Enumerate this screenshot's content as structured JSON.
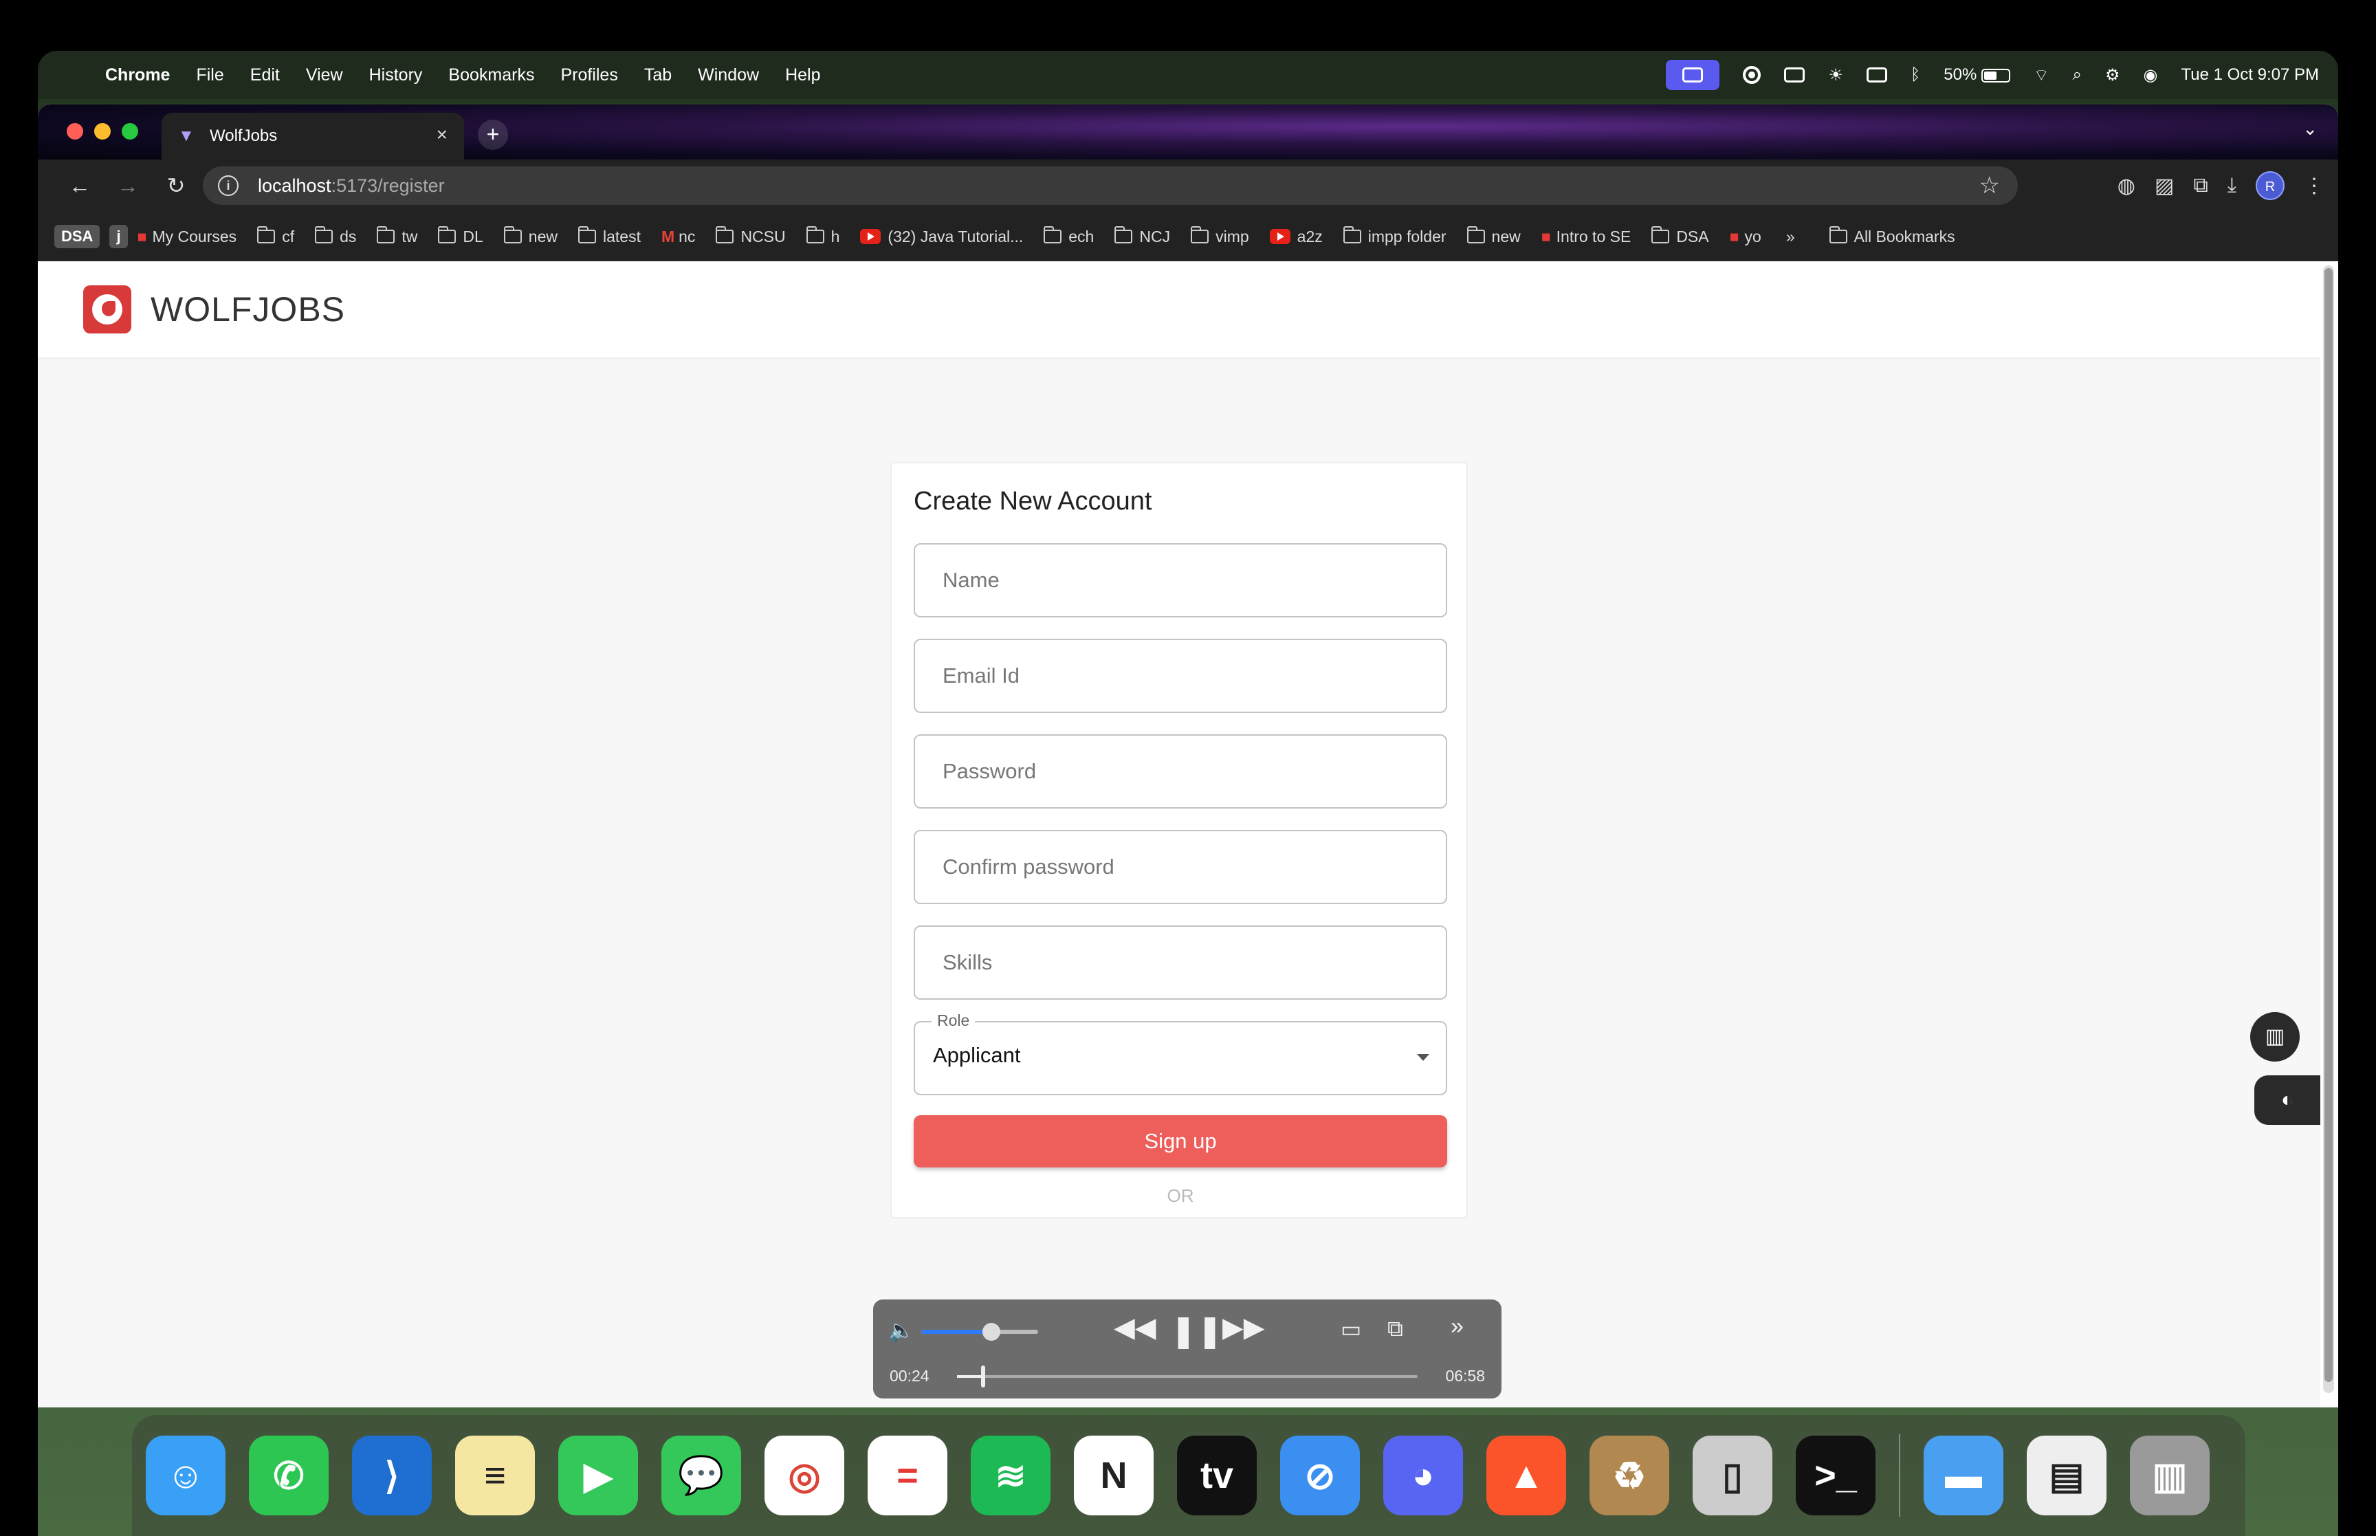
{
  "menubar": {
    "app": "Chrome",
    "items": [
      "File",
      "Edit",
      "View",
      "History",
      "Bookmarks",
      "Profiles",
      "Tab",
      "Window",
      "Help"
    ],
    "battery": "50%",
    "datetime": "Tue 1 Oct  9:07 PM"
  },
  "browser": {
    "tab_title": "WolfJobs",
    "url_host": "localhost",
    "url_path": ":5173/register",
    "bookmarks": [
      {
        "label": "DSA",
        "kind": "pill"
      },
      {
        "label": "j",
        "kind": "pill"
      },
      {
        "label": "My Courses",
        "kind": "site"
      },
      {
        "label": "cf",
        "kind": "folder"
      },
      {
        "label": "ds",
        "kind": "folder"
      },
      {
        "label": "tw",
        "kind": "folder"
      },
      {
        "label": "DL",
        "kind": "folder"
      },
      {
        "label": "new",
        "kind": "folder"
      },
      {
        "label": "latest",
        "kind": "folder"
      },
      {
        "label": "nc",
        "kind": "gmail"
      },
      {
        "label": "NCSU",
        "kind": "folder"
      },
      {
        "label": "h",
        "kind": "folder"
      },
      {
        "label": "(32) Java Tutorial...",
        "kind": "youtube"
      },
      {
        "label": "ech",
        "kind": "folder"
      },
      {
        "label": "NCJ",
        "kind": "folder"
      },
      {
        "label": "vimp",
        "kind": "folder"
      },
      {
        "label": "a2z",
        "kind": "youtube"
      },
      {
        "label": "impp folder",
        "kind": "folder"
      },
      {
        "label": "new",
        "kind": "folder"
      },
      {
        "label": "Intro to SE",
        "kind": "site"
      },
      {
        "label": "DSA",
        "kind": "folder"
      },
      {
        "label": "yo",
        "kind": "site"
      }
    ],
    "more_bookmarks": "»",
    "all_bookmarks": "All Bookmarks",
    "profile_initial": "R"
  },
  "page": {
    "brand": "WOLFJOBS",
    "form_title": "Create New Account",
    "fields": {
      "name": "Name",
      "email": "Email Id",
      "password": "Password",
      "confirm": "Confirm password",
      "skills": "Skills"
    },
    "role_label": "Role",
    "role_value": "Applicant",
    "signup": "Sign up",
    "or_text": "OR"
  },
  "video": {
    "current_time": "00:24",
    "total_time": "06:58",
    "progress": 0.057,
    "volume": 0.6
  },
  "dock": {
    "apps": [
      "Finder",
      "WhatsApp",
      "VS Code",
      "Notes",
      "FaceTime",
      "Messages",
      "Chrome",
      "Toolbox",
      "Spotify",
      "Notion",
      "Apple TV",
      "Safari",
      "Discord",
      "Brave",
      "Archiver",
      "iPhone Mirroring",
      "Terminal",
      "Folder",
      "Document",
      "Trash"
    ]
  },
  "colors": {
    "accent": "#ee5e5a",
    "brand_red": "#d83a3a",
    "seek_blue": "#2f7bf5"
  }
}
